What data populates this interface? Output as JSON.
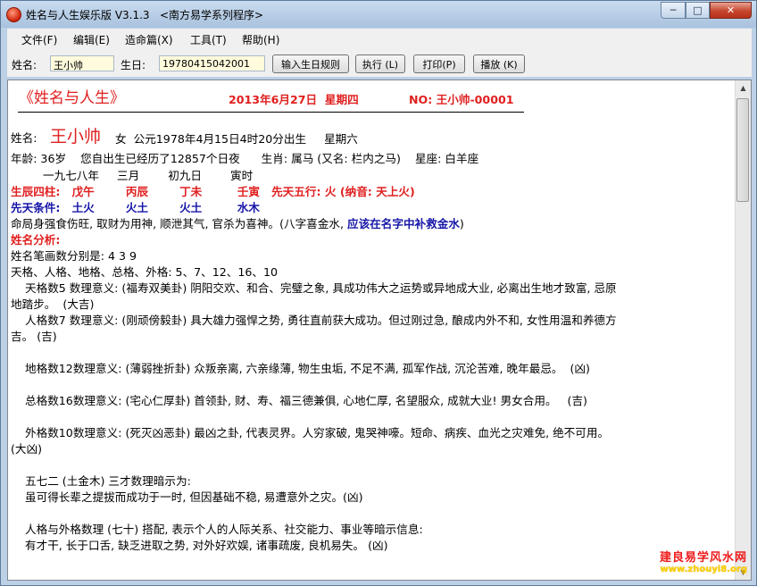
{
  "window": {
    "title": "姓名与人生娱乐版 V3.1.3   <南方易学系列程序>",
    "min_label": "─",
    "max_label": "□",
    "close_label": "✕"
  },
  "menu": [
    "文件(F)",
    "编辑(E)",
    "造命篇(X)",
    "工具(T)",
    "帮助(H)"
  ],
  "toolbar": {
    "name_label": "姓名:",
    "name_value": "王小帅",
    "birthday_label": "生日:",
    "birthday_value": "19780415042001",
    "rule_button": "输入生日规则",
    "run_button": "执行 (L)",
    "print_button": "打印(P)",
    "play_button": "播放 (K)"
  },
  "doc": {
    "title": "《姓名与人生》",
    "date": "2013年6月27日  星期四",
    "no": "NO: 王小帅-00001",
    "divider": "------------------------------------------------------------------------",
    "name_prefix": "姓名:",
    "name_big": "王小帅",
    "name_rest": "  女  公元1978年4月15日4时20分出生     星期六",
    "age_line": "年龄: 36岁    您自出生已经历了12857个日夜      生肖: 属马 (又名: 栏内之马)    星座: 白羊座",
    "lunar_line": "         一九七八年     三月        初九日        寅时",
    "sizhu_line": "生辰四柱:   戊午        丙辰        丁未         壬寅   先天五行: 火 (纳音: 天上火)",
    "tiaojian_line": "先天条件:   土火        火土        火土         水木",
    "mingju_text": "命局身强食伤旺, 取财为用神, 顺泄其气, 官杀为喜神。(八字喜金水, ",
    "mingju_advice": "应该在名字中补救金水",
    "mingju_end": ")",
    "analysis_heading": "姓名分析:",
    "strokes_line": "姓名笔画数分别是: 4 3 9",
    "grids_line": "天格、人格、地格、总格、外格: 5、7、12、16、10",
    "tiange_1": "    天格数5 数理意义: (福寿双美卦) 阴阳交欢、和合、完璧之象, 具成功伟大之运势或异地成大业, 必离出生地才致富, 忌原",
    "tiange_2": "地踏步。  (大吉)",
    "renge_1": "    人格数7 数理意义: (刚顽傍毅卦) 具大雄力强悍之势, 勇往直前获大成功。但过刚过急, 酿成内外不和, 女性用温和养德方",
    "renge_2": "吉。 (吉)",
    "dige": "    地格数12数理意义: (薄弱挫折卦) 众叛亲离, 六亲缘薄, 物生虫垢, 不足不满, 孤军作战, 沉沦苦难, 晚年最忌。  (凶)",
    "zongge": "    总格数16数理意义: (宅心仁厚卦) 首领卦, 财、寿、福三德兼俱, 心地仁厚, 名望服众, 成就大业! 男女合用。   (吉)",
    "waige_1": "    外格数10数理意义: (死灭凶恶卦) 最凶之卦, 代表灵界。人穷家破, 鬼哭神嚎。短命、病疾、血光之灾难免, 绝不可用。",
    "waige_2": "(大凶)",
    "sancai_1": "    五七二 (土金木) 三才数理暗示为:",
    "sancai_2": "    虽可得长辈之提拔而成功于一时, 但因基础不稳, 易遭意外之灾。(凶)",
    "social_1": "    人格与外格数理 (七十) 搭配, 表示个人的人际关系、社交能力、事业等暗示信息:",
    "social_2": "    有才干, 长于口舌, 缺乏进取之势, 对外好欢娱, 诸事疏废, 良机易失。 (凶)"
  },
  "watermark": {
    "line1": "建良易学风水网",
    "line2": "www.zhouyi8.org"
  },
  "colors": {
    "accent_red": "#e02020",
    "accent_blue": "#1616a8",
    "input_bg": "#fffbdc"
  }
}
